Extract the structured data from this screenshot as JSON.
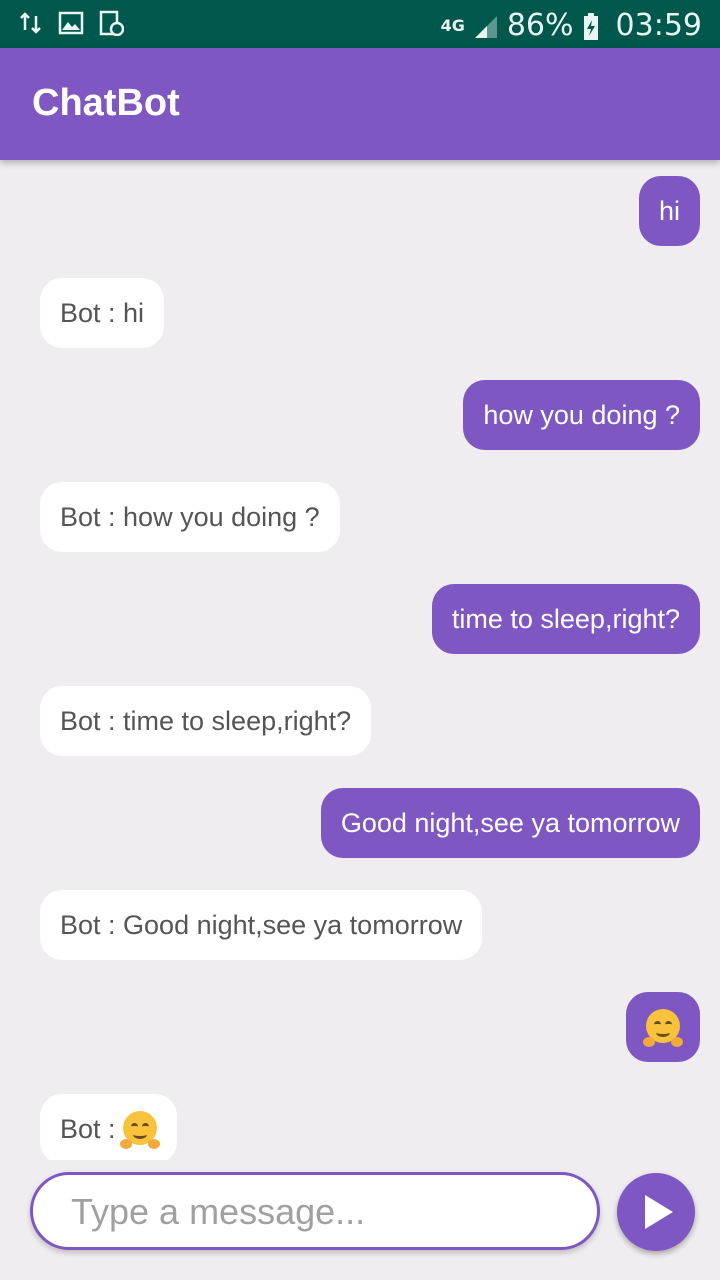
{
  "status_bar": {
    "network": "4G",
    "battery": "86%",
    "time": "03:59",
    "icons": [
      "data-arrows-icon",
      "gallery-icon",
      "screenshot-icon",
      "signal-icon",
      "battery-charging-icon"
    ]
  },
  "app_bar": {
    "title": "ChatBot"
  },
  "messages": [
    {
      "sender": "user",
      "text": "hi"
    },
    {
      "sender": "bot",
      "text": "Bot : hi"
    },
    {
      "sender": "user",
      "text": "how you doing ?"
    },
    {
      "sender": "bot",
      "text": "Bot : how you doing ?"
    },
    {
      "sender": "user",
      "text": "time to sleep,right?"
    },
    {
      "sender": "bot",
      "text": "Bot : time to sleep,right?"
    },
    {
      "sender": "user",
      "text": "Good night,see ya tomorrow"
    },
    {
      "sender": "bot",
      "text": "Bot : Good night,see ya tomorrow"
    },
    {
      "sender": "user",
      "text": "",
      "emoji": "hugging-face-emoji"
    },
    {
      "sender": "bot",
      "text": "Bot : ",
      "emoji": "hugging-face-emoji"
    }
  ],
  "composer": {
    "placeholder": "Type a message...",
    "value": "",
    "send_icon": "send-icon"
  },
  "colors": {
    "status_bar": "#00574b",
    "accent": "#7e57c2",
    "background": "#efedef",
    "bot_bubble": "#ffffff"
  }
}
